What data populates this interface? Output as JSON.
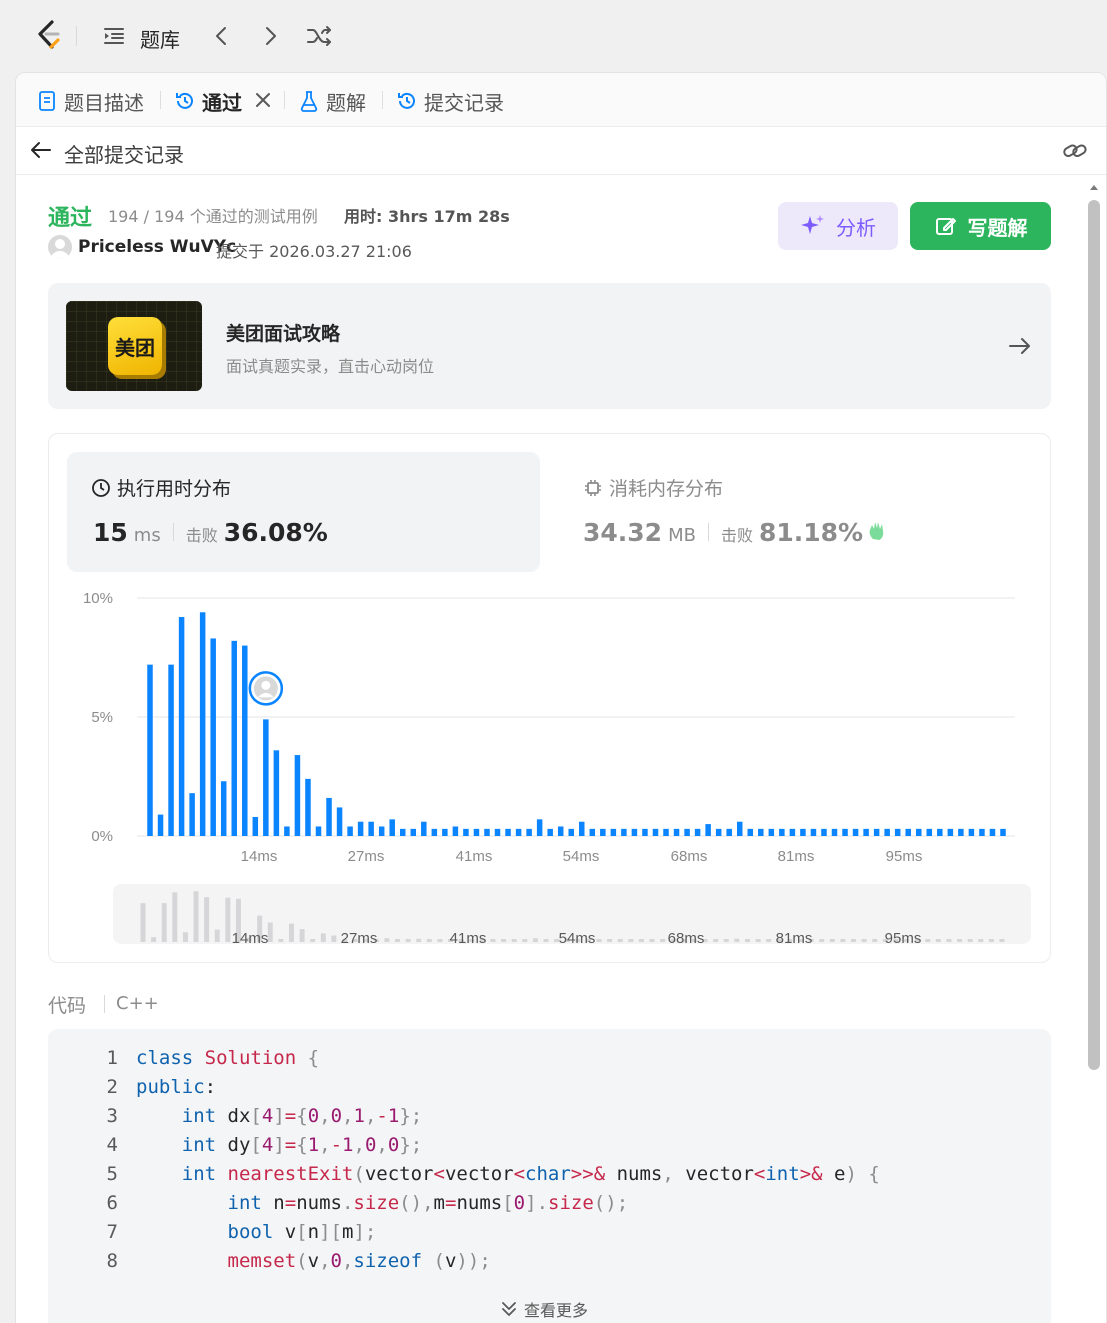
{
  "topbar": {
    "title": "题库"
  },
  "tabs": [
    {
      "label": "题目描述"
    },
    {
      "label": "通过"
    },
    {
      "label": "题解"
    },
    {
      "label": "提交记录"
    }
  ],
  "subhead": {
    "title": "全部提交记录"
  },
  "submission": {
    "status": "通过",
    "cases": "194 / 194 个通过的测试用例",
    "runtime": "用时: 3hrs 17m 28s",
    "user": "Priceless WuVYc",
    "submitted": "提交于 2026.03.27 21:06"
  },
  "buttons": {
    "analyze": "分析",
    "write": "写题解"
  },
  "promo": {
    "badge": "美团",
    "title": "美团面试攻略",
    "subtitle": "面试真题实录，直击心动岗位"
  },
  "stats": {
    "time": {
      "title": "执行用时分布",
      "value": "15",
      "unit": "ms",
      "beat_label": "击败",
      "beat": "36.08%"
    },
    "memory": {
      "title": "消耗内存分布",
      "value": "34.32",
      "unit": "MB",
      "beat_label": "击败",
      "beat": "81.18%"
    }
  },
  "chart_data": {
    "type": "bar",
    "ylabel": "",
    "yticks": [
      "10%",
      "5%",
      "0%"
    ],
    "ylim": [
      0,
      10
    ],
    "xticks": [
      "14ms",
      "27ms",
      "41ms",
      "54ms",
      "68ms",
      "81ms",
      "95ms"
    ],
    "highlight_index": 11,
    "values": [
      7.2,
      0.9,
      7.2,
      9.2,
      1.8,
      9.4,
      8.3,
      2.3,
      8.2,
      8.0,
      0.8,
      4.9,
      3.6,
      0.4,
      3.4,
      2.4,
      0.4,
      1.6,
      1.2,
      0.4,
      0.6,
      0.6,
      0.4,
      0.7,
      0.3,
      0.3,
      0.6,
      0.3,
      0.3,
      0.4,
      0.3,
      0.3,
      0.3,
      0.3,
      0.3,
      0.3,
      0.3,
      0.7,
      0.3,
      0.4,
      0.3,
      0.6,
      0.3,
      0.3,
      0.3,
      0.3,
      0.3,
      0.3,
      0.3,
      0.3,
      0.3,
      0.3,
      0.3,
      0.5,
      0.3,
      0.3,
      0.6,
      0.3,
      0.3,
      0.3,
      0.3,
      0.3,
      0.3,
      0.3,
      0.3,
      0.3,
      0.3,
      0.3,
      0.3,
      0.3,
      0.3,
      0.3,
      0.3,
      0.3,
      0.3,
      0.3,
      0.3,
      0.3,
      0.3,
      0.3,
      0.3,
      0.3
    ],
    "grid": true,
    "color": "#0a84ff"
  },
  "code": {
    "label": "代码",
    "lang": "C++",
    "more": "查看更多",
    "lines": [
      "class Solution {",
      "public:",
      "    int dx[4]={0,0,1,-1};",
      "    int dy[4]={1,-1,0,0};",
      "    int nearestExit(vector<vector<char>>& nums, vector<int>& e) {",
      "        int n=nums.size(),m=nums[0].size();",
      "        bool v[n][m];",
      "        memset(v,0,sizeof (v));"
    ]
  },
  "colors": {
    "accent": "#2db55d",
    "bar": "#0a84ff",
    "purple": "#7c5cff"
  }
}
